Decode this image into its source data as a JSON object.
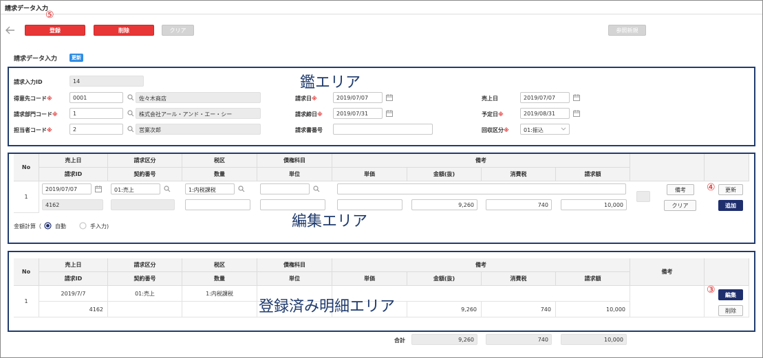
{
  "window": {
    "title": "請求データ入力"
  },
  "toolbar": {
    "register": "登録",
    "delete": "削除",
    "clear": "クリア",
    "ref_new": "参照新規"
  },
  "markers": {
    "m5": "⑤",
    "m4": "④",
    "m3": "③"
  },
  "section": {
    "title": "請求データ入力",
    "badge": "更新"
  },
  "header_area": {
    "area_label": "鑑エリア",
    "fields": {
      "billing_id": {
        "label": "請求入力ID",
        "value": "14"
      },
      "customer_code": {
        "label": "得意先コード",
        "value": "0001",
        "name": "佐々木商店"
      },
      "dept_code": {
        "label": "請求部門コード",
        "value": "1",
        "name": "株式会社アール・アンド・エー・シー"
      },
      "staff_code": {
        "label": "担当者コード",
        "value": "2",
        "name": "営業次郎"
      },
      "billing_date": {
        "label": "請求日",
        "value": "2019/07/07"
      },
      "closing_date": {
        "label": "請求締日",
        "value": "2019/07/31"
      },
      "doc_number": {
        "label": "請求書番号",
        "value": ""
      },
      "sales_date": {
        "label": "売上日",
        "value": "2019/07/07"
      },
      "due_date": {
        "label": "予定日",
        "value": "2019/08/31"
      },
      "collection_type": {
        "label": "回収区分",
        "value": "01:振込"
      }
    },
    "required_mark": "※"
  },
  "edit_area": {
    "area_label": "編集エリア",
    "headers_top": [
      "No",
      "売上日",
      "請求区分",
      "税区",
      "債権科目",
      "備考"
    ],
    "headers_bottom": [
      "請求ID",
      "契約番号",
      "数量",
      "単位",
      "単価",
      "金額(抜)",
      "消費税",
      "請求額"
    ],
    "row": {
      "no": "1",
      "sales_date": "2019/07/07",
      "billing_type": "01:売上",
      "tax": "1:内税課税",
      "billing_id": "4162",
      "amount": "9,260",
      "tax_amount": "740",
      "total": "10,000"
    },
    "buttons": {
      "remarks": "備考",
      "update": "更新",
      "clear": "クリア",
      "add": "追加"
    },
    "calc": {
      "label": "金額計算（",
      "auto": "自動",
      "manual": "手入力)"
    }
  },
  "registered_area": {
    "area_label": "登録済み明細エリア",
    "headers_top": [
      "No",
      "売上日",
      "請求区分",
      "税区",
      "債権科目",
      "備考",
      "備考"
    ],
    "headers_bottom": [
      "請求ID",
      "契約番号",
      "数量",
      "単位",
      "単価",
      "金額(抜)",
      "消費税",
      "請求額"
    ],
    "row": {
      "no": "1",
      "sales_date": "2019/7/7",
      "billing_type": "01:売上",
      "tax": "1:内税課税",
      "billing_id": "4162",
      "amount": "9,260",
      "tax_amount": "740",
      "total": "10,000"
    },
    "buttons": {
      "edit": "編集",
      "delete": "削除"
    }
  },
  "totals": {
    "label": "合計",
    "amount": "9,260",
    "tax": "740",
    "total": "10,000"
  }
}
